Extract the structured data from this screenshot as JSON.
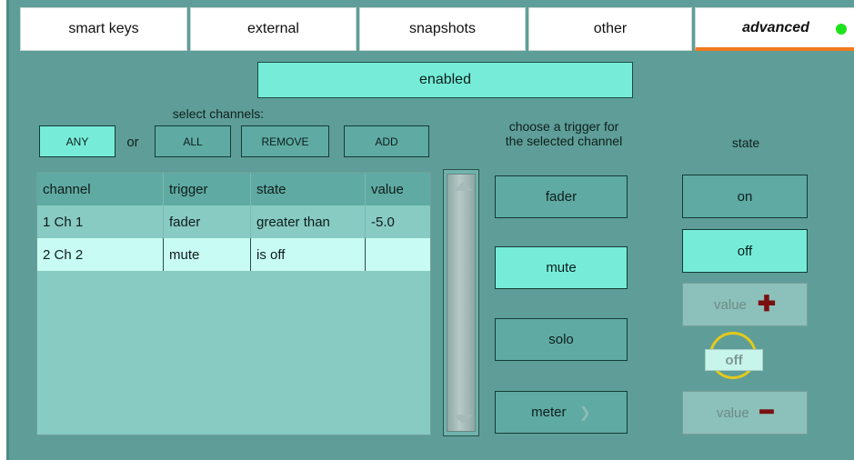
{
  "tabs": [
    {
      "label": "smart keys"
    },
    {
      "label": "external"
    },
    {
      "label": "snapshots"
    },
    {
      "label": "other"
    },
    {
      "label": "advanced",
      "active": true,
      "indicator": "green-dot"
    }
  ],
  "enabled_button": "enabled",
  "select_channels": {
    "label": "select channels:",
    "any": "ANY",
    "or": "or",
    "all": "ALL",
    "remove": "REMOVE",
    "add": "ADD"
  },
  "table": {
    "headers": [
      "channel",
      "trigger",
      "state",
      "value"
    ],
    "rows": [
      {
        "channel": "1 Ch 1",
        "trigger": "fader",
        "state": "greater than",
        "value": "-5.0"
      },
      {
        "channel": "2 Ch 2",
        "trigger": "mute",
        "state": "is off",
        "value": "",
        "selected": true
      }
    ]
  },
  "trigger": {
    "heading_line1": "choose a trigger for",
    "heading_line2": "the selected channel",
    "buttons": [
      "fader",
      "mute",
      "solo",
      "meter"
    ],
    "active": "mute"
  },
  "state": {
    "heading": "state",
    "on": "on",
    "off": "off",
    "value_plus": "value",
    "value_minus": "value",
    "knob_value": "off"
  },
  "colors": {
    "panel": "#5f9e98",
    "active_button": "#76ecd8",
    "tab_underline": "#f07a1f",
    "status_dot": "#1de21d",
    "knob_ring": "#e3c91c"
  }
}
